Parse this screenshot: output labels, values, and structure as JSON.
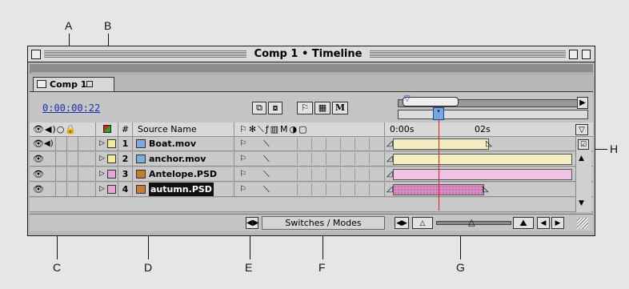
{
  "callouts": {
    "a": "A",
    "b": "B",
    "c": "C",
    "d": "D",
    "e": "E",
    "f": "F",
    "g": "G",
    "h": "H"
  },
  "window": {
    "title": "Comp 1 • Timeline"
  },
  "tab": {
    "label": "Comp 1"
  },
  "timecode": "0:00:00:22",
  "columns": {
    "num": "#",
    "source_name": "Source Name",
    "time_0": "0:00s",
    "time_2": "02s"
  },
  "layers": [
    {
      "num": "1",
      "name": "Boat.mov",
      "label_color": "#f2ec9b",
      "bar_color": "#f2eec2",
      "has_audio": true,
      "icon": "movie-icon"
    },
    {
      "num": "2",
      "name": "anchor.mov",
      "label_color": "#f2ec9b",
      "bar_color": "#f2eec2",
      "has_audio": false,
      "icon": "movie-icon"
    },
    {
      "num": "3",
      "name": "Antelope.PSD",
      "label_color": "#e6a6d6",
      "bar_color": "#eec4e2",
      "has_audio": false,
      "icon": "image-icon"
    },
    {
      "num": "4",
      "name": "autumn.PSD",
      "label_color": "#e6a6d6",
      "bar_color": "#d88bc4",
      "has_audio": false,
      "icon": "image-icon",
      "selected": true
    }
  ],
  "footer": {
    "switches_modes": "Switches / Modes"
  },
  "colors": {
    "time_indicator": "#e02020",
    "timecode": "#1a2fb0"
  }
}
